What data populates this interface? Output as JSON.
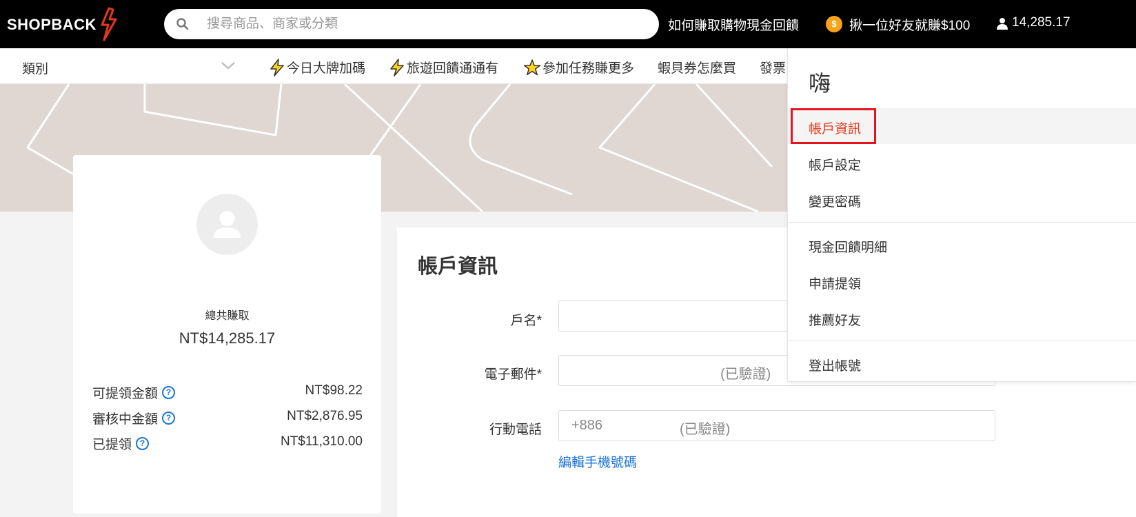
{
  "brand": {
    "name": "SHOPBACK",
    "accent": "#e8371b"
  },
  "search": {
    "placeholder": "搜尋商品、商家或分類",
    "value": ""
  },
  "header": {
    "how_to_earn": "如何賺取購物現金回饋",
    "coin_symbol": "$",
    "refer_promo": "揪一位好友就賺$100",
    "balance": "14,285.17"
  },
  "nav": {
    "category_label": "類別",
    "items": [
      {
        "icon": "lightning-icon",
        "label": "今日大牌加碼"
      },
      {
        "icon": "lightning-icon",
        "label": "旅遊回饋通通有"
      },
      {
        "icon": "star-icon",
        "label": "參加任務賺更多"
      },
      {
        "icon": "",
        "label": "蝦貝券怎麼買"
      },
      {
        "icon": "",
        "label": "發票"
      }
    ]
  },
  "profile": {
    "total_label": "總共賺取",
    "total_value": "NT$14,285.17",
    "rows": [
      {
        "label": "可提領金額",
        "value": "NT$98.22"
      },
      {
        "label": "審核中金額",
        "value": "NT$2,876.95"
      },
      {
        "label": "已提領",
        "value": "NT$11,310.00"
      }
    ]
  },
  "form": {
    "title": "帳戶資訊",
    "name_label": "戶名*",
    "email_label": "電子郵件*",
    "email_status": "(已驗證)",
    "phone_label": "行動電話",
    "phone_prefix": "+886",
    "phone_status": "(已驗證)",
    "edit_phone_link": "編輯手機號碼"
  },
  "dropdown": {
    "greeting": "嗨",
    "items": [
      {
        "label": "帳戶資訊",
        "active": true
      },
      {
        "label": "帳戶設定"
      },
      {
        "label": "變更密碼"
      },
      {
        "label": "現金回饋明細"
      },
      {
        "label": "申請提領"
      },
      {
        "label": "推薦好友"
      },
      {
        "label": "登出帳號"
      }
    ]
  }
}
